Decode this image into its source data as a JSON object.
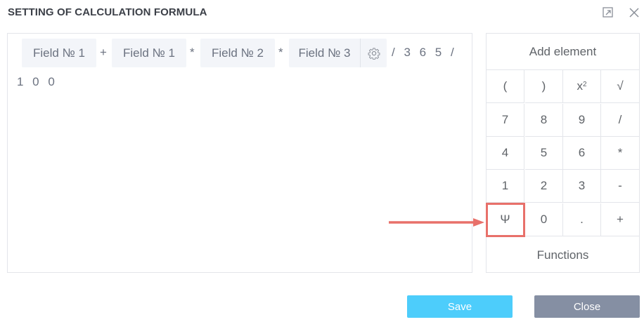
{
  "dialog": {
    "title": "SETTING OF CALCULATION FORMULA",
    "icons": {
      "expand": "expand-icon",
      "close": "close-icon"
    }
  },
  "formula": {
    "chips": [
      {
        "label": "Field № 1"
      },
      {
        "label": "Field № 1"
      },
      {
        "label": "Field № 2"
      },
      {
        "label": "Field № 3",
        "settings_icon": "gear-icon"
      }
    ],
    "operators": [
      "+",
      "*",
      "*"
    ],
    "tail_line1": "/ 3 6 5 /",
    "tail_line2": "1 0 0"
  },
  "keypad": {
    "header": "Add element",
    "rows": [
      [
        "(",
        ")",
        "x2",
        "√"
      ],
      [
        "7",
        "8",
        "9",
        "/"
      ],
      [
        "4",
        "5",
        "6",
        "*"
      ],
      [
        "1",
        "2",
        "3",
        "-"
      ],
      [
        "Ψ",
        "0",
        ".",
        "+"
      ]
    ],
    "highlighted_key": "Ψ",
    "footer": "Functions"
  },
  "annotation": {
    "arrow_color": "#e8706a"
  },
  "buttons": {
    "save": "Save",
    "close": "Close"
  },
  "colors": {
    "save_bg": "#4dcdfb",
    "close_bg": "#858fa3",
    "highlight": "#e8706a"
  }
}
